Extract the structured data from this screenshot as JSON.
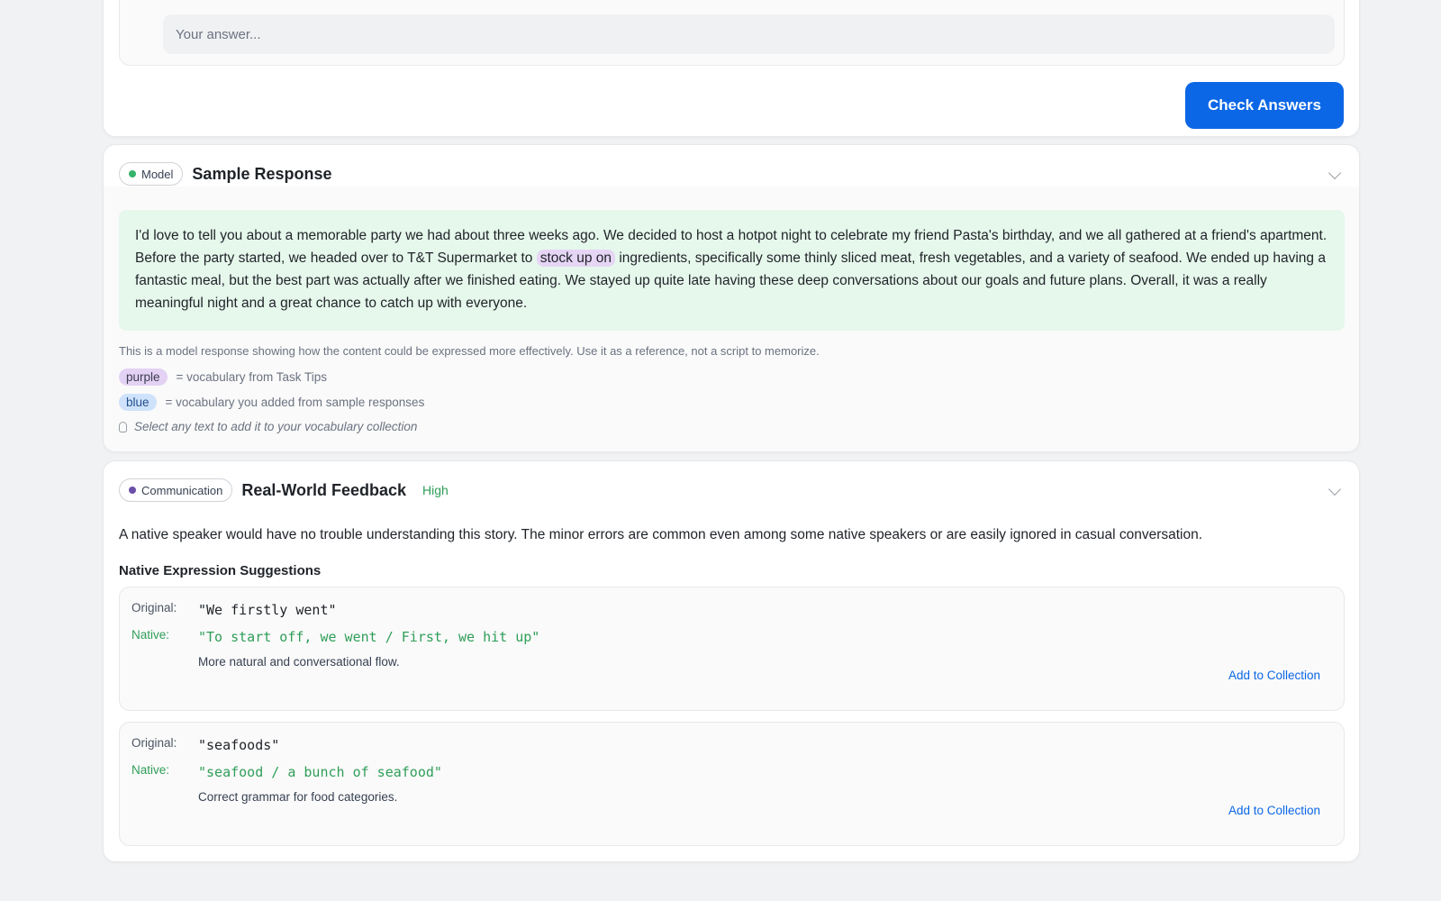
{
  "quiz": {
    "answer_placeholder": "Your answer...",
    "check_button": "Check Answers"
  },
  "sample": {
    "pill_label": "Model",
    "pill_dot_color": "#36b36a",
    "title": "Sample Response",
    "text_before": "I'd love to tell you about a memorable party we had about three weeks ago. We decided to host a hotpot night to celebrate my friend Pasta's birthday, and we all gathered at a friend's apartment. Before the party started, we headed over to T&T Supermarket to ",
    "highlight": "stock up on",
    "text_after": " ingredients, specifically some thinly sliced meat, fresh vegetables, and a variety of seafood. We ended up having a fantastic meal, but the best part was actually after we finished eating. We stayed up quite late having these deep conversations about our goals and future plans. Overall, it was a really meaningful night and a great chance to catch up with everyone.",
    "note": "This is a model response showing how the content could be expressed more effectively. Use it as a reference, not a script to memorize.",
    "legend": [
      {
        "tag": "purple",
        "desc": "= vocabulary from Task Tips"
      },
      {
        "tag": "blue",
        "desc": "= vocabulary you added from sample responses"
      }
    ],
    "hint": "Select any text to add it to your vocabulary collection"
  },
  "feedback": {
    "pill_label": "Communication",
    "pill_dot_color": "#6b4fa8",
    "title": "Real-World Feedback",
    "level": "High",
    "summary": "A native speaker would have no trouble understanding this story. The minor errors are common even among some native speakers or are easily ignored in casual conversation.",
    "suggestions_title": "Native Expression Suggestions",
    "original_label": "Original:",
    "native_label": "Native:",
    "add_label": "Add to Collection",
    "suggestions": [
      {
        "original": "\"We firstly went\"",
        "native": "\"To start off, we went / First, we hit up\"",
        "reason": "More natural and conversational flow."
      },
      {
        "original": "\"seafoods\"",
        "native": "\"seafood / a bunch of seafood\"",
        "reason": "Correct grammar for food categories."
      }
    ]
  }
}
